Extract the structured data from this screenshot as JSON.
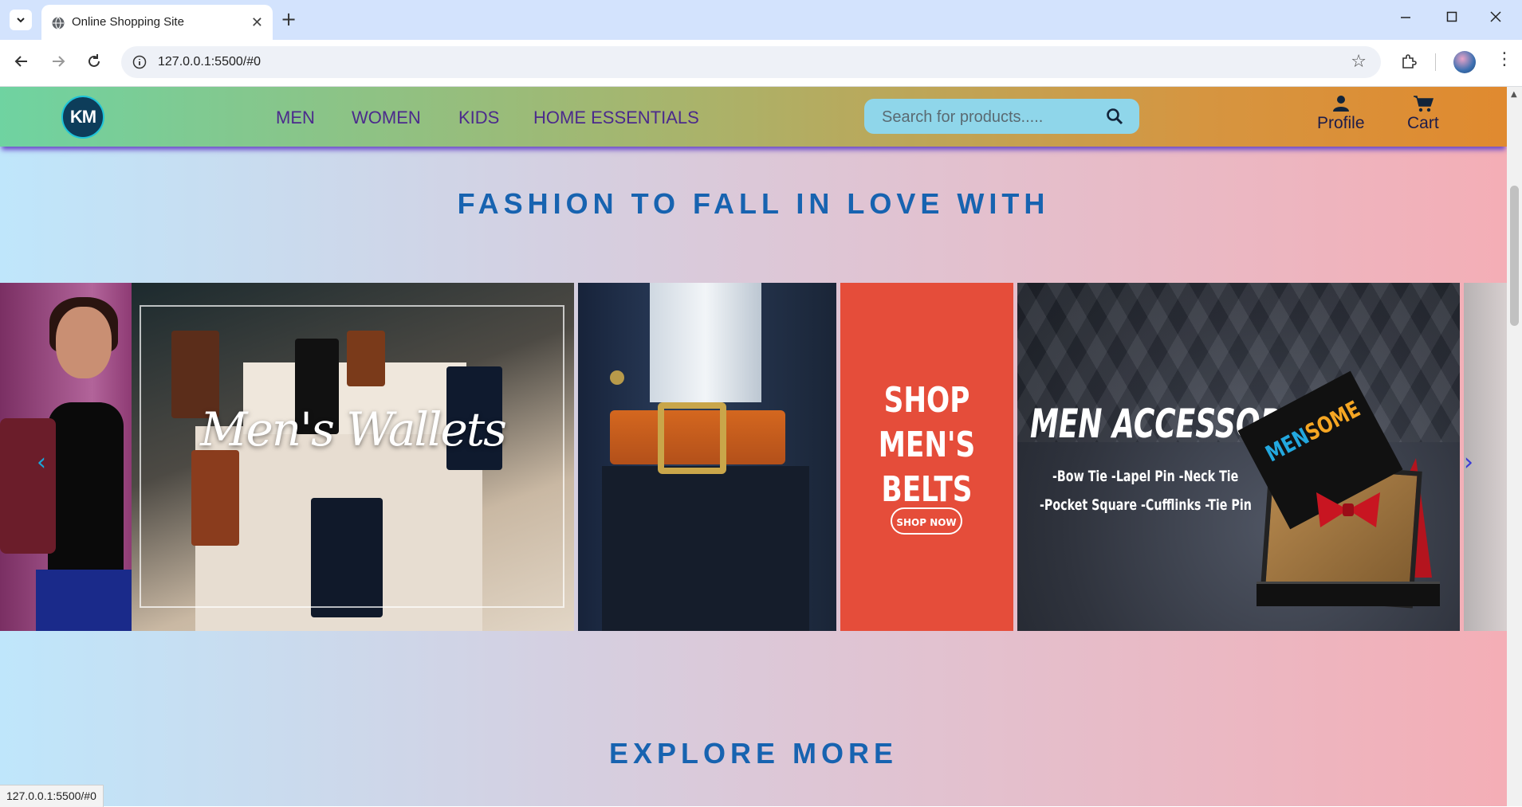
{
  "browser": {
    "tab_title": "Online Shopping Site",
    "tab_close": "✕",
    "new_tab": "+",
    "url": "127.0.0.1:5500/#0",
    "status_url": "127.0.0.1:5500/#0"
  },
  "site": {
    "logo_text": "KM",
    "nav": [
      "MEN",
      "WOMEN",
      "KIDS",
      "HOME ESSENTIALS"
    ],
    "search_placeholder": "Search for products.....",
    "profile_label": "Profile",
    "cart_label": "Cart",
    "accent_header": "#6a49c9",
    "heading_color": "#1763b0"
  },
  "hero": {
    "heading": "FASHION TO FALL IN LOVE WITH",
    "slides": {
      "wallets": "Men's Wallets",
      "belts_title": "SHOP MEN'S BELTS",
      "belts_button": "SHOP NOW",
      "accessories_title": "MEN ACCESSORIES",
      "accessories_line1": "-Bow Tie -Lapel Pin -Neck Tie",
      "accessories_line2": "-Pocket Square -Cufflinks -Tie Pin",
      "accessories_brand_a": "MEN",
      "accessories_brand_b": "SOME"
    },
    "prev": "‹",
    "next": "›"
  },
  "explore": {
    "heading": "EXPLORE MORE"
  }
}
